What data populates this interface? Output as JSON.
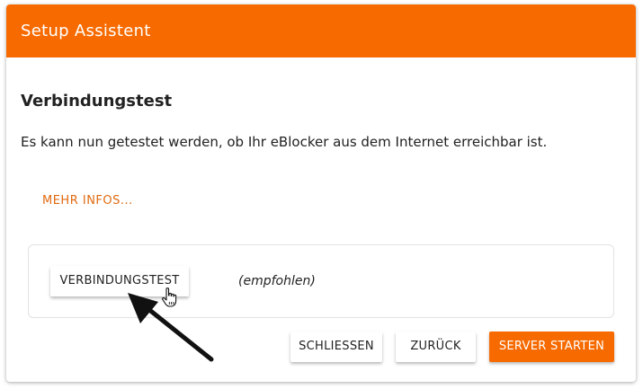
{
  "dialog": {
    "title": "Setup Assistent",
    "heading": "Verbindungstest",
    "description": "Es kann nun getestet werden, ob Ihr eBlocker aus dem Internet erreichbar ist.",
    "more_info_label": "MEHR INFOS..."
  },
  "test_panel": {
    "test_button_label": "VERBINDUNGSTEST",
    "recommended_label": "(empfohlen)"
  },
  "footer": {
    "close_label": "SCHLIESSEN",
    "back_label": "ZURÜCK",
    "start_label": "SERVER STARTEN"
  },
  "colors": {
    "accent": "#f76a00",
    "link": "#e06a10"
  },
  "icons": {
    "cursor": "hand-pointer-icon",
    "annotation": "arrow-icon"
  }
}
